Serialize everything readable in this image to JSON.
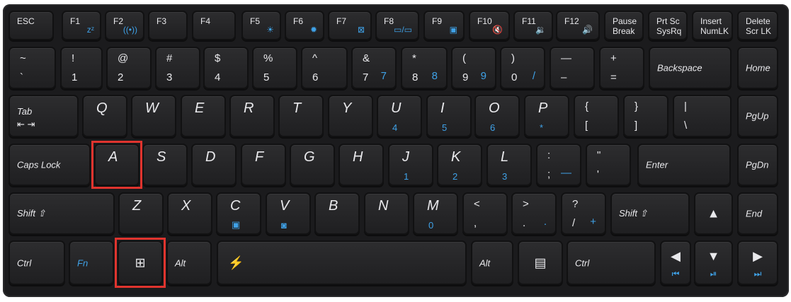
{
  "keyboard": {
    "row_f": [
      {
        "id": "esc",
        "main": "ESC"
      },
      {
        "id": "f1",
        "main": "F1",
        "sub": "zᶻ"
      },
      {
        "id": "f2",
        "main": "F2",
        "sub": "((•))"
      },
      {
        "id": "f3",
        "main": "F3"
      },
      {
        "id": "f4",
        "main": "F4"
      },
      {
        "id": "f5",
        "main": "F5",
        "sub": "☀"
      },
      {
        "id": "f6",
        "main": "F6",
        "sub": "✹"
      },
      {
        "id": "f7",
        "main": "F7",
        "sub": "⊠"
      },
      {
        "id": "f8",
        "main": "F8",
        "sub": "▭/▭"
      },
      {
        "id": "f9",
        "main": "F9",
        "sub": "▣"
      },
      {
        "id": "f10",
        "main": "F10",
        "sub": "🔇"
      },
      {
        "id": "f11",
        "main": "F11",
        "sub": "🔉"
      },
      {
        "id": "f12",
        "main": "F12",
        "sub": "🔊"
      },
      {
        "id": "pause",
        "main": "Pause",
        "sub": "Break"
      },
      {
        "id": "prtsc",
        "main": "Prt Sc",
        "sub": "SysRq"
      },
      {
        "id": "insert",
        "main": "Insert",
        "sub": "NumLK"
      },
      {
        "id": "delete",
        "main": "Delete",
        "sub": "Scr LK"
      }
    ],
    "row_num": [
      {
        "id": "tilde",
        "top": "~",
        "bottom": "`"
      },
      {
        "id": "1",
        "top": "!",
        "bottom": "1"
      },
      {
        "id": "2",
        "top": "@",
        "bottom": "2"
      },
      {
        "id": "3",
        "top": "#",
        "bottom": "3"
      },
      {
        "id": "4",
        "top": "$",
        "bottom": "4"
      },
      {
        "id": "5",
        "top": "%",
        "bottom": "5"
      },
      {
        "id": "6",
        "top": "^",
        "bottom": "6"
      },
      {
        "id": "7",
        "top": "&",
        "bottom": "7",
        "alt": "7"
      },
      {
        "id": "8",
        "top": "*",
        "bottom": "8",
        "alt": "8"
      },
      {
        "id": "9",
        "top": "(",
        "bottom": "9",
        "alt": "9"
      },
      {
        "id": "0",
        "top": ")",
        "bottom": "0",
        "alt": "/"
      },
      {
        "id": "minus",
        "top": "—",
        "bottom": "–"
      },
      {
        "id": "plus",
        "top": "+",
        "bottom": "="
      },
      {
        "id": "backspace",
        "main": "Backspace"
      },
      {
        "id": "home",
        "main": "Home"
      }
    ],
    "row_q": [
      {
        "id": "tab",
        "main": "Tab"
      },
      {
        "id": "q",
        "main": "Q"
      },
      {
        "id": "w",
        "main": "W"
      },
      {
        "id": "e",
        "main": "E"
      },
      {
        "id": "r",
        "main": "R"
      },
      {
        "id": "t",
        "main": "T"
      },
      {
        "id": "y",
        "main": "Y"
      },
      {
        "id": "u",
        "main": "U",
        "alt": "4"
      },
      {
        "id": "i",
        "main": "I",
        "alt": "5"
      },
      {
        "id": "o",
        "main": "O",
        "alt": "6"
      },
      {
        "id": "p",
        "main": "P",
        "alt": "*"
      },
      {
        "id": "lbrace",
        "top": "{",
        "bottom": "["
      },
      {
        "id": "rbrace",
        "top": "}",
        "bottom": "]"
      },
      {
        "id": "pipe",
        "top": "|",
        "bottom": "\\"
      },
      {
        "id": "pgup",
        "main": "PgUp"
      }
    ],
    "row_a": [
      {
        "id": "capslock",
        "main": "Caps Lock"
      },
      {
        "id": "a",
        "main": "A"
      },
      {
        "id": "s",
        "main": "S"
      },
      {
        "id": "d",
        "main": "D"
      },
      {
        "id": "f",
        "main": "F"
      },
      {
        "id": "g",
        "main": "G"
      },
      {
        "id": "h",
        "main": "H"
      },
      {
        "id": "j",
        "main": "J",
        "alt": "1"
      },
      {
        "id": "k",
        "main": "K",
        "alt": "2"
      },
      {
        "id": "l",
        "main": "L",
        "alt": "3"
      },
      {
        "id": "semicolon",
        "top": ":",
        "bottom": ";",
        "alt": "—"
      },
      {
        "id": "quote",
        "top": "\"",
        "bottom": "'"
      },
      {
        "id": "enter",
        "main": "Enter"
      },
      {
        "id": "pgdn",
        "main": "PgDn"
      }
    ],
    "row_z": [
      {
        "id": "lshift",
        "main": "Shift ⇧"
      },
      {
        "id": "z",
        "main": "Z"
      },
      {
        "id": "x",
        "main": "X"
      },
      {
        "id": "c",
        "main": "C",
        "alt": "▣"
      },
      {
        "id": "v",
        "main": "V",
        "alt": "◙"
      },
      {
        "id": "b",
        "main": "B"
      },
      {
        "id": "n",
        "main": "N"
      },
      {
        "id": "m",
        "main": "M",
        "alt": "0"
      },
      {
        "id": "comma",
        "top": "<",
        "bottom": ","
      },
      {
        "id": "period",
        "top": ">",
        "bottom": ".",
        "alt": "."
      },
      {
        "id": "slash",
        "top": "?",
        "bottom": "/",
        "alt": "+"
      },
      {
        "id": "rshift",
        "main": "Shift ⇧"
      },
      {
        "id": "up",
        "main": "▲"
      },
      {
        "id": "end",
        "main": "End"
      }
    ],
    "row_bottom": [
      {
        "id": "lctrl",
        "main": "Ctrl"
      },
      {
        "id": "fn",
        "main": "Fn"
      },
      {
        "id": "win",
        "main": "⊞"
      },
      {
        "id": "lalt",
        "main": "Alt"
      },
      {
        "id": "space",
        "main": "⚡"
      },
      {
        "id": "ralt",
        "main": "Alt"
      },
      {
        "id": "menu",
        "main": "▤"
      },
      {
        "id": "rctrl",
        "main": "Ctrl"
      },
      {
        "id": "left",
        "main": "◀",
        "alt": "⏮"
      },
      {
        "id": "down",
        "main": "▼",
        "alt": "⏯"
      },
      {
        "id": "right",
        "main": "▶",
        "alt": "⏭"
      }
    ]
  },
  "highlights": [
    "a",
    "win"
  ],
  "colors": {
    "key": "#262628",
    "frame": "#1b1b1d",
    "legend": "#e9e9ec",
    "fn_blue": "#3fa2e8",
    "highlight": "#e0342e"
  }
}
